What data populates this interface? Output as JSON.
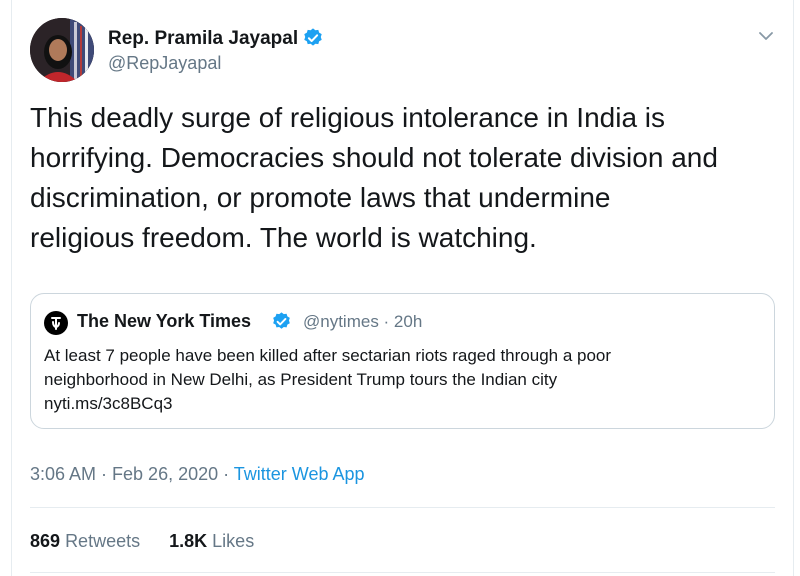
{
  "author": {
    "display_name": "Rep. Pramila Jayapal",
    "handle": "@RepJayapal",
    "verified": true
  },
  "icons": {
    "verified_icon": "verified-badge-icon",
    "caret_icon": "chevron-down-icon",
    "quote_logo_icon": "nyt-logo-icon"
  },
  "tweet": {
    "text_lines": [
      "This deadly surge of religious intolerance in India is",
      "horrifying. Democracies should not tolerate division and",
      "discrimination, or promote laws that undermine",
      "religious freedom. The world is watching."
    ]
  },
  "quoted_tweet": {
    "display_name": "The New York Times",
    "handle_time": "@nytimes · 20h",
    "verified": true,
    "text_lines": [
      "At least 7 people have been killed after sectarian riots raged through a poor",
      "neighborhood in New Delhi, as President Trump tours the Indian city",
      "nyti.ms/3c8BCq3"
    ]
  },
  "meta": {
    "timestamp": "3:06 AM · Feb 26, 2020 · ",
    "source": "Twitter Web App"
  },
  "stats": {
    "retweets_count": "869",
    "retweets_label": "Retweets",
    "likes_count": "1.8K",
    "likes_label": "Likes"
  },
  "colors": {
    "verified_blue": "#1da1f2",
    "link_blue": "#1b95e0",
    "secondary_text": "#657786",
    "border": "#e6ecf0"
  }
}
